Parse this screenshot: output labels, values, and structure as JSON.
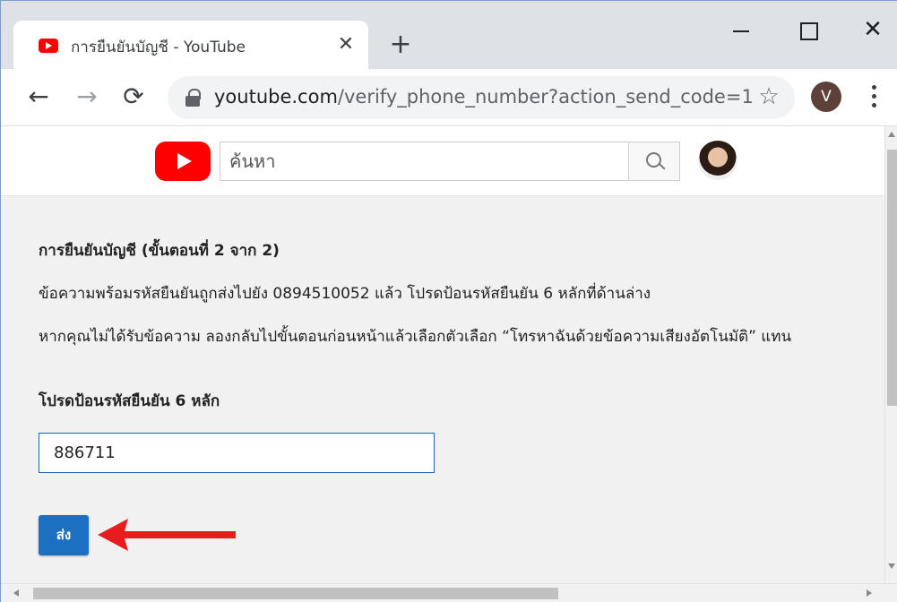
{
  "browser": {
    "tab_title": "การยืนยันบัญชี - YouTube",
    "tab_close": "✕",
    "new_tab": "+",
    "close_window": "✕",
    "back": "←",
    "forward": "→",
    "reload": "⟳",
    "url_host": "youtube.com",
    "url_path": "/verify_phone_number?action_send_code=1",
    "bookmark": "☆",
    "profile_initial": "V"
  },
  "header": {
    "search_placeholder": "ค้นหา"
  },
  "verify": {
    "heading": "การยืนยันบัญชี (ขั้นตอนที่ 2 จาก 2)",
    "sent_message": "ข้อความพร้อมรหัสยืนยันถูกส่งไปยัง 0894510052 แล้ว โปรดป้อนรหัสยืนยัน 6 หลักที่ด้านล่าง",
    "fallback_message": "หากคุณไม่ได้รับข้อความ ลองกลับไปขั้นตอนก่อนหน้าแล้วเลือกตัวเลือก “โทรหาฉันด้วยข้อความเสียงอัตโนมัติ” แทน",
    "code_label": "โปรดป้อนรหัสยืนยัน 6 หลัก",
    "code_value": "886711",
    "submit_label": "ส่ง"
  },
  "colors": {
    "accent": "#1d6fc2",
    "annotation_arrow": "#e81c1c",
    "youtube_red": "#ff0000"
  }
}
